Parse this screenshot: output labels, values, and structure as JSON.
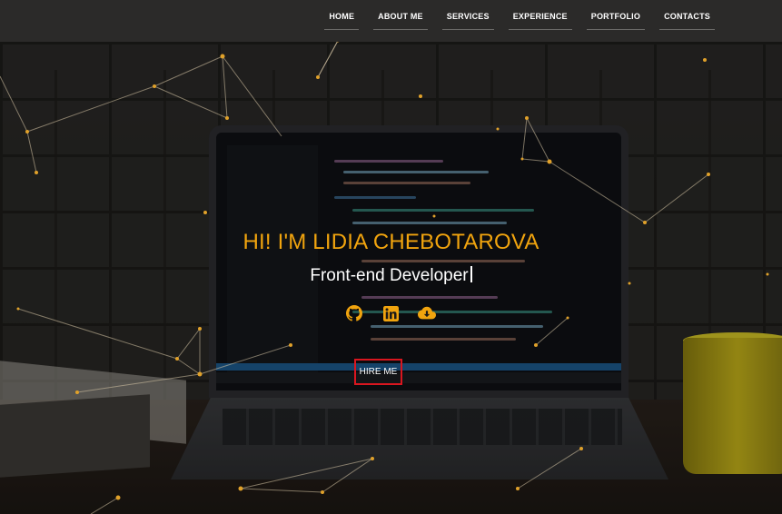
{
  "nav": {
    "items": [
      {
        "label": "HOME"
      },
      {
        "label": "ABOUT ME"
      },
      {
        "label": "SERVICES"
      },
      {
        "label": "EXPERIENCE"
      },
      {
        "label": "PORTFOLIO"
      },
      {
        "label": "CONTACTS"
      }
    ]
  },
  "hero": {
    "title": "HI! I'M LIDIA CHEBOTAROVA",
    "subtitle": "Front-end Developer",
    "hire_label": "HIRE ME"
  },
  "socials": [
    {
      "icon": "github-icon"
    },
    {
      "icon": "linkedin-icon"
    },
    {
      "icon": "cloud-download-icon"
    }
  ],
  "colors": {
    "accent": "#f1a40e",
    "nav_bg": "#2b2a29",
    "button_border": "#d9161f",
    "text": "#ffffff"
  }
}
